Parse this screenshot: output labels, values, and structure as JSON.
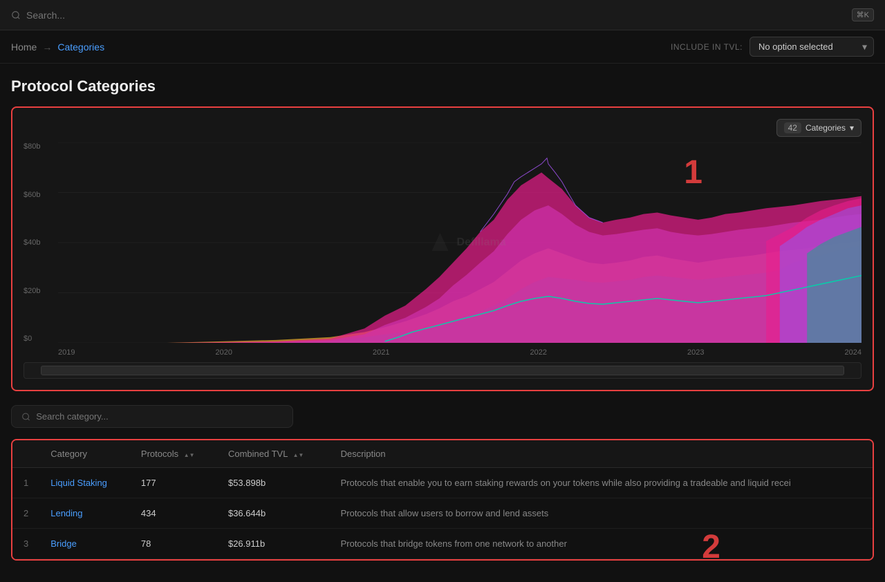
{
  "topbar": {
    "search_placeholder": "Search...",
    "shortcut": "⌘K"
  },
  "breadcrumb": {
    "home": "Home",
    "arrow": "→",
    "current": "Categories"
  },
  "tvl": {
    "label": "INCLUDE IN TVL:",
    "select_default": "No option selected"
  },
  "page": {
    "title": "Protocol Categories"
  },
  "chart": {
    "categories_count": "42",
    "categories_label": "Categories",
    "y_labels": [
      "$80b",
      "$60b",
      "$40b",
      "$20b",
      "$0"
    ],
    "x_labels": [
      "2019",
      "2020",
      "2021",
      "2022",
      "2023",
      "2024"
    ],
    "number_annotation": "1"
  },
  "search_category": {
    "placeholder": "Search category..."
  },
  "table": {
    "number_annotation": "2",
    "columns": [
      {
        "label": "Category",
        "sortable": false
      },
      {
        "label": "Protocols",
        "sortable": true
      },
      {
        "label": "Combined TVL",
        "sortable": true
      },
      {
        "label": "Description",
        "sortable": false
      }
    ],
    "rows": [
      {
        "rank": "1",
        "category": "Liquid Staking",
        "protocols": "177",
        "combined_tvl": "$53.898b",
        "description": "Protocols that enable you to earn staking rewards on your tokens while also providing a tradeable and liquid recei"
      },
      {
        "rank": "2",
        "category": "Lending",
        "protocols": "434",
        "combined_tvl": "$36.644b",
        "description": "Protocols that allow users to borrow and lend assets"
      },
      {
        "rank": "3",
        "category": "Bridge",
        "protocols": "78",
        "combined_tvl": "$26.911b",
        "description": "Protocols that bridge tokens from one network to another"
      }
    ]
  }
}
